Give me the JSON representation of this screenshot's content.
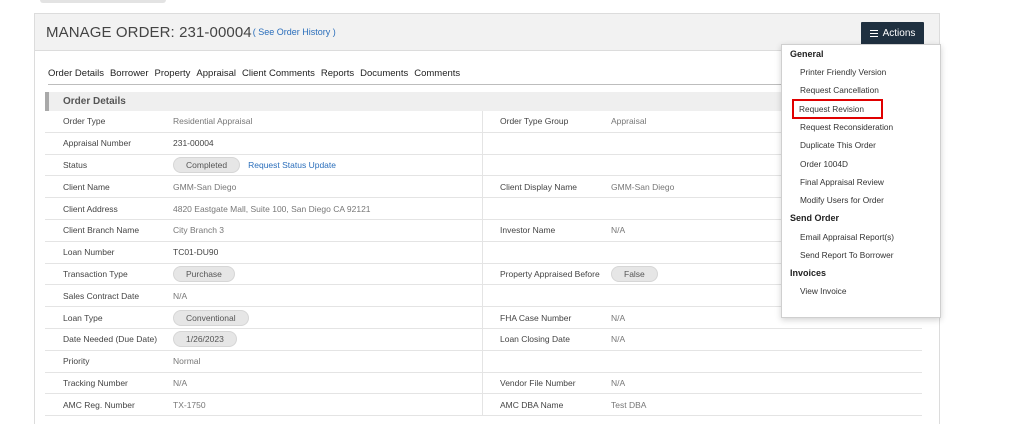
{
  "header": {
    "title": "MANAGE ORDER: 231-00004",
    "history_link": "( See Order History )",
    "actions_label": "Actions"
  },
  "tabs": [
    {
      "label": "Order Details"
    },
    {
      "label": "Borrower"
    },
    {
      "label": "Property"
    },
    {
      "label": "Appraisal"
    },
    {
      "label": "Client Comments"
    },
    {
      "label": "Reports"
    },
    {
      "label": "Documents"
    },
    {
      "label": "Comments"
    }
  ],
  "section": {
    "title": "Order Details",
    "rows": [
      {
        "l_label": "Order Type",
        "l_value": "Residential Appraisal",
        "r_label": "Order Type Group",
        "r_value": "Appraisal"
      },
      {
        "l_label": "Appraisal Number",
        "l_value": "231-00004",
        "r_label": "",
        "r_value": ""
      },
      {
        "l_label": "Status",
        "l_value": "Completed",
        "l_link": "Request Status Update",
        "r_label": "",
        "r_value": ""
      },
      {
        "l_label": "Client Name",
        "l_value": "GMM-San Diego",
        "r_label": "Client Display Name",
        "r_value": "GMM-San Diego"
      },
      {
        "l_label": "Client Address",
        "l_value": "4820 Eastgate Mall, Suite 100, San Diego CA 92121",
        "r_label": "",
        "r_value": ""
      },
      {
        "l_label": "Client Branch Name",
        "l_value": "City Branch 3",
        "r_label": "Investor Name",
        "r_value": "N/A"
      },
      {
        "l_label": "Loan Number",
        "l_value": "TC01-DU90",
        "r_label": "",
        "r_value": ""
      },
      {
        "l_label": "Transaction Type",
        "l_value": "Purchase",
        "r_label": "Property Appraised Before",
        "r_value": "False"
      },
      {
        "l_label": "Sales Contract Date",
        "l_value": "N/A",
        "r_label": "",
        "r_value": ""
      },
      {
        "l_label": "Loan Type",
        "l_value": "Conventional",
        "r_label": "FHA Case Number",
        "r_value": "N/A"
      },
      {
        "l_label": "Date Needed (Due Date)",
        "l_value": "1/26/2023",
        "r_label": "Loan Closing Date",
        "r_value": "N/A"
      },
      {
        "l_label": "Priority",
        "l_value": "Normal",
        "r_label": "",
        "r_value": ""
      },
      {
        "l_label": "Tracking Number",
        "l_value": "N/A",
        "r_label": "Vendor File Number",
        "r_value": "N/A"
      },
      {
        "l_label": "AMC Reg. Number",
        "l_value": "TX-1750",
        "r_label": "AMC DBA Name",
        "r_value": "Test DBA"
      }
    ]
  },
  "actions_menu": {
    "groups": [
      {
        "title": "General",
        "items": [
          "Printer Friendly Version",
          "Request Cancellation",
          "Request Revision",
          "Request Reconsideration",
          "Duplicate This Order",
          "Order 1004D",
          "Final Appraisal Review",
          "Modify Users for Order"
        ]
      },
      {
        "title": "Send Order",
        "items": [
          "Email Appraisal Report(s)",
          "Send Report To Borrower"
        ]
      },
      {
        "title": "Invoices",
        "items": [
          "View Invoice"
        ]
      }
    ],
    "highlighted_item": "Request Revision",
    "highlight_color": "#e00000"
  },
  "colors": {
    "actions_button": "#1f3040",
    "link": "#2a6ebb"
  }
}
